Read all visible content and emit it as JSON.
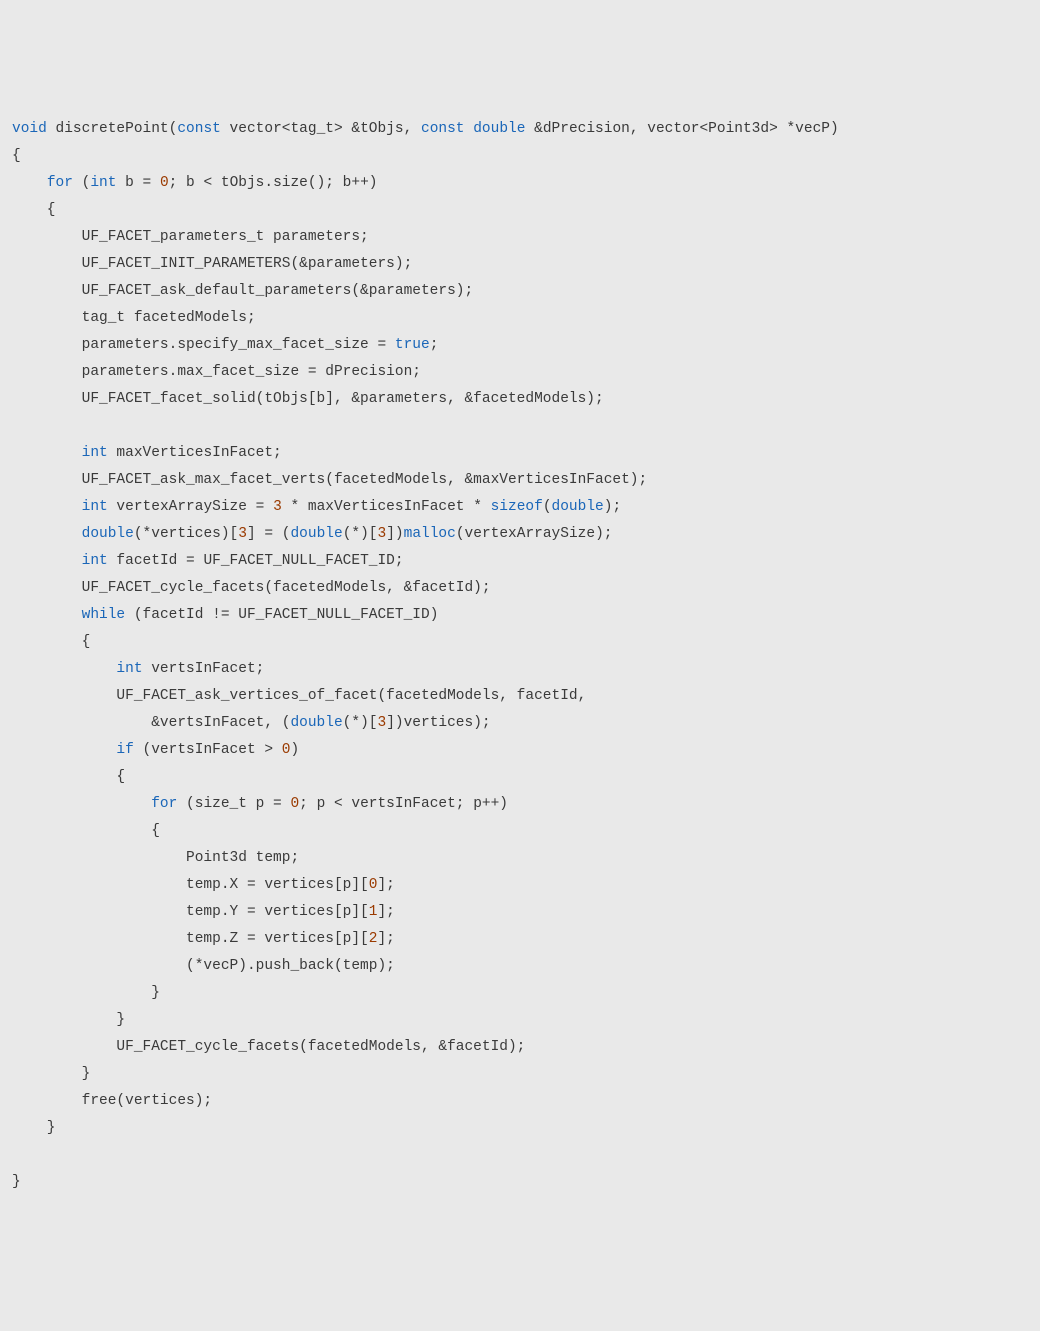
{
  "code": {
    "lines": [
      [
        {
          "t": "void",
          "c": "tok-kw"
        },
        {
          "t": " discretePoint("
        },
        {
          "t": "const",
          "c": "tok-kw"
        },
        {
          "t": " vector<tag_t> &tObjs, "
        },
        {
          "t": "const",
          "c": "tok-kw"
        },
        {
          "t": " "
        },
        {
          "t": "double",
          "c": "tok-kw"
        },
        {
          "t": " &dPrecision, vector<Point3d> *vecP)"
        }
      ],
      [
        {
          "t": "{"
        }
      ],
      [
        {
          "t": "    "
        },
        {
          "t": "for",
          "c": "tok-kw"
        },
        {
          "t": " ("
        },
        {
          "t": "int",
          "c": "tok-kw"
        },
        {
          "t": " b = "
        },
        {
          "t": "0",
          "c": "tok-num"
        },
        {
          "t": "; b < tObjs.size(); b++)"
        }
      ],
      [
        {
          "t": "    {"
        }
      ],
      [
        {
          "t": "        UF_FACET_parameters_t parameters;"
        }
      ],
      [
        {
          "t": "        UF_FACET_INIT_PARAMETERS(&parameters);"
        }
      ],
      [
        {
          "t": "        UF_FACET_ask_default_parameters(&parameters);"
        }
      ],
      [
        {
          "t": "        tag_t facetedModels;"
        }
      ],
      [
        {
          "t": "        parameters.specify_max_facet_size = "
        },
        {
          "t": "true",
          "c": "tok-kw"
        },
        {
          "t": ";"
        }
      ],
      [
        {
          "t": "        parameters.max_facet_size = dPrecision;"
        }
      ],
      [
        {
          "t": "        UF_FACET_facet_solid(tObjs[b], &parameters, &facetedModels);"
        }
      ],
      [
        {
          "t": " "
        }
      ],
      [
        {
          "t": "        "
        },
        {
          "t": "int",
          "c": "tok-kw"
        },
        {
          "t": " maxVerticesInFacet;"
        }
      ],
      [
        {
          "t": "        UF_FACET_ask_max_facet_verts(facetedModels, &maxVerticesInFacet);"
        }
      ],
      [
        {
          "t": "        "
        },
        {
          "t": "int",
          "c": "tok-kw"
        },
        {
          "t": " vertexArraySize = "
        },
        {
          "t": "3",
          "c": "tok-num"
        },
        {
          "t": " * maxVerticesInFacet * "
        },
        {
          "t": "sizeof",
          "c": "tok-kw"
        },
        {
          "t": "("
        },
        {
          "t": "double",
          "c": "tok-kw"
        },
        {
          "t": ");"
        }
      ],
      [
        {
          "t": "        "
        },
        {
          "t": "double",
          "c": "tok-kw"
        },
        {
          "t": "(*vertices)["
        },
        {
          "t": "3",
          "c": "tok-num"
        },
        {
          "t": "] = ("
        },
        {
          "t": "double",
          "c": "tok-kw"
        },
        {
          "t": "(*)["
        },
        {
          "t": "3",
          "c": "tok-num"
        },
        {
          "t": "])"
        },
        {
          "t": "malloc",
          "c": "tok-fn"
        },
        {
          "t": "(vertexArraySize);"
        }
      ],
      [
        {
          "t": "        "
        },
        {
          "t": "int",
          "c": "tok-kw"
        },
        {
          "t": " facetId = UF_FACET_NULL_FACET_ID;"
        }
      ],
      [
        {
          "t": "        UF_FACET_cycle_facets(facetedModels, &facetId);"
        }
      ],
      [
        {
          "t": "        "
        },
        {
          "t": "while",
          "c": "tok-kw"
        },
        {
          "t": " (facetId != UF_FACET_NULL_FACET_ID)"
        }
      ],
      [
        {
          "t": "        {"
        }
      ],
      [
        {
          "t": "            "
        },
        {
          "t": "int",
          "c": "tok-kw"
        },
        {
          "t": " vertsInFacet;"
        }
      ],
      [
        {
          "t": "            UF_FACET_ask_vertices_of_facet(facetedModels, facetId,"
        }
      ],
      [
        {
          "t": "                &vertsInFacet, ("
        },
        {
          "t": "double",
          "c": "tok-kw"
        },
        {
          "t": "(*)["
        },
        {
          "t": "3",
          "c": "tok-num"
        },
        {
          "t": "])vertices);"
        }
      ],
      [
        {
          "t": "            "
        },
        {
          "t": "if",
          "c": "tok-kw"
        },
        {
          "t": " (vertsInFacet > "
        },
        {
          "t": "0",
          "c": "tok-num"
        },
        {
          "t": ")"
        }
      ],
      [
        {
          "t": "            {"
        }
      ],
      [
        {
          "t": "                "
        },
        {
          "t": "for",
          "c": "tok-kw"
        },
        {
          "t": " (size_t p = "
        },
        {
          "t": "0",
          "c": "tok-num"
        },
        {
          "t": "; p < vertsInFacet; p++)"
        }
      ],
      [
        {
          "t": "                {"
        }
      ],
      [
        {
          "t": "                    Point3d temp;"
        }
      ],
      [
        {
          "t": "                    temp.X = vertices[p]["
        },
        {
          "t": "0",
          "c": "tok-num"
        },
        {
          "t": "];"
        }
      ],
      [
        {
          "t": "                    temp.Y = vertices[p]["
        },
        {
          "t": "1",
          "c": "tok-num"
        },
        {
          "t": "];"
        }
      ],
      [
        {
          "t": "                    temp.Z = vertices[p]["
        },
        {
          "t": "2",
          "c": "tok-num"
        },
        {
          "t": "];"
        }
      ],
      [
        {
          "t": "                    (*vecP).push_back(temp);"
        }
      ],
      [
        {
          "t": "                }"
        }
      ],
      [
        {
          "t": "            }"
        }
      ],
      [
        {
          "t": "            UF_FACET_cycle_facets(facetedModels, &facetId);"
        }
      ],
      [
        {
          "t": "        }"
        }
      ],
      [
        {
          "t": "        free(vertices);"
        }
      ],
      [
        {
          "t": "    }"
        }
      ],
      [
        {
          "t": " "
        }
      ],
      [
        {
          "t": "}"
        }
      ]
    ]
  }
}
